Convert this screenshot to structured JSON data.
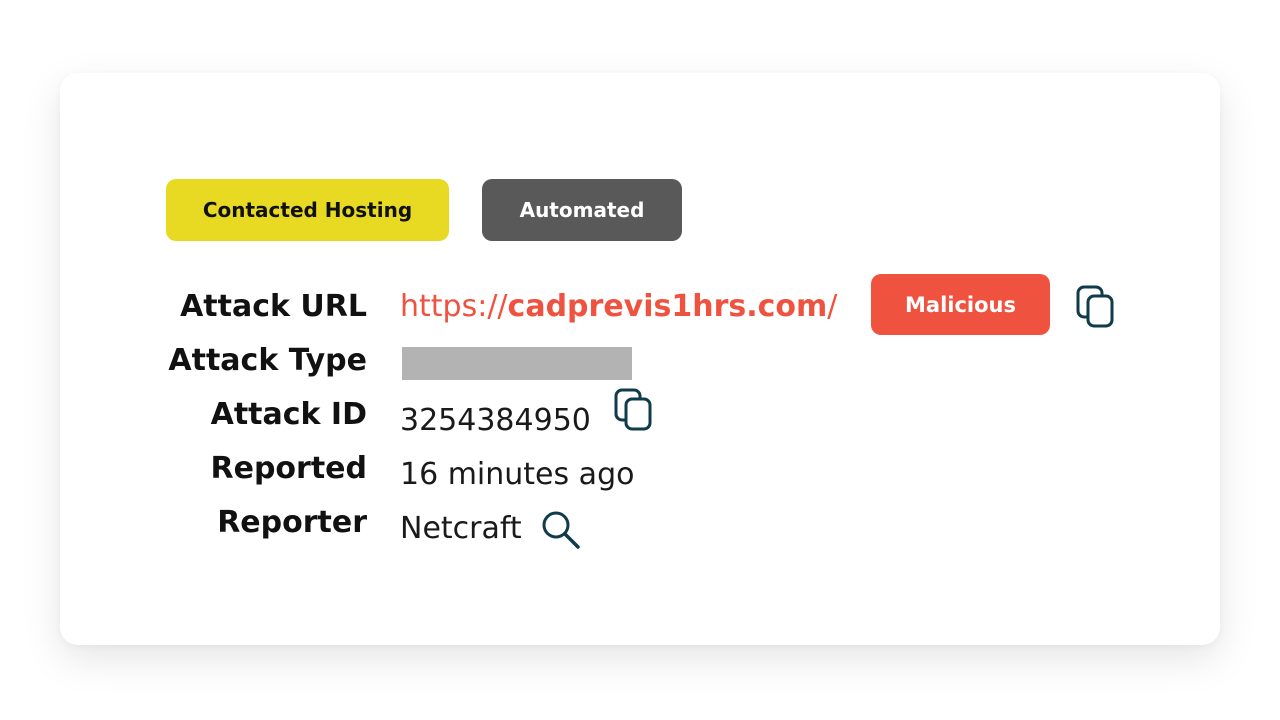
{
  "tags": {
    "hosting": "Contacted Hosting",
    "automated": "Automated"
  },
  "fields": {
    "attack_url": {
      "label": "Attack URL",
      "prefix": "https://",
      "domain": "cadprevis1hrs.com",
      "suffix": "/",
      "status": "Malicious"
    },
    "attack_type": {
      "label": "Attack Type",
      "value": ""
    },
    "attack_id": {
      "label": "Attack ID",
      "value": "3254384950"
    },
    "reported": {
      "label": "Reported",
      "value": "16 minutes ago"
    },
    "reporter": {
      "label": "Reporter",
      "value": "Netcraft"
    }
  },
  "icons": {
    "url_copy": "copy-icon",
    "id_copy": "copy-icon",
    "reporter_search": "search-icon"
  },
  "colors": {
    "hosting_tag": "#e8da22",
    "automated_tag": "#595959",
    "malicious": "#ef5340",
    "icon": "#0f3b4a",
    "redacted": "#b3b3b3"
  }
}
